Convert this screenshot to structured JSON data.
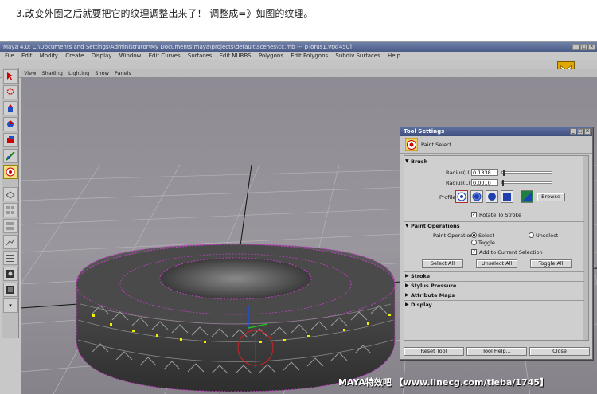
{
  "caption": "3.改变外圈之后就要把它的纹理调整出来了！ 调整成=》如图的纹理。",
  "maya": {
    "title": "Maya 4.0: C:\\Documents and Settings\\Administrator\\My Documents\\maya\\projects\\default\\scenes\\cc.mb --- pTorus1.vtx[450]",
    "menu": [
      "File",
      "Edit",
      "Modify",
      "Create",
      "Display",
      "Window",
      "Edit Curves",
      "Surfaces",
      "Edit NURBS",
      "Polygons",
      "Edit Polygons",
      "Subdiv Surfaces",
      "Help"
    ],
    "viewport_menu": [
      "View",
      "Shading",
      "Lighting",
      "Show",
      "Panels"
    ]
  },
  "tool_settings": {
    "title": "Tool Settings",
    "tool_name": "Paint Select",
    "brush": {
      "header": "Brush",
      "radius_u_label": "Radius(U)",
      "radius_u_value": "0.1338",
      "radius_l_label": "Radius(L)",
      "radius_l_value": "0.0010",
      "profile_label": "Profile",
      "browse_label": "Browse",
      "rotate_to_stroke_label": "Rotate To Stroke",
      "rotate_to_stroke_checked": true
    },
    "paint_operations": {
      "header": "Paint Operations",
      "paint_operation_label": "Paint Operation",
      "select_label": "Select",
      "unselect_label": "Unselect",
      "toggle_label": "Toggle",
      "selected_option": "Select",
      "add_to_current_label": "Add to Current Selection",
      "add_to_current_checked": true,
      "select_all_label": "Select All",
      "unselect_all_label": "Unselect All",
      "toggle_all_label": "Toggle All"
    },
    "collapsed_sections": [
      "Stroke",
      "Stylus Pressure",
      "Attribute Maps",
      "Display"
    ],
    "footer": {
      "reset_label": "Reset Tool",
      "help_label": "Tool Help...",
      "close_label": "Close"
    }
  },
  "watermark": "MAYA特效吧 【www.linecg.com/tieba/1745】",
  "colors": {
    "selection_magenta": "#c040c0",
    "selected_vertex_yellow": "#f0f000",
    "title_blue": "#4b5b86"
  }
}
